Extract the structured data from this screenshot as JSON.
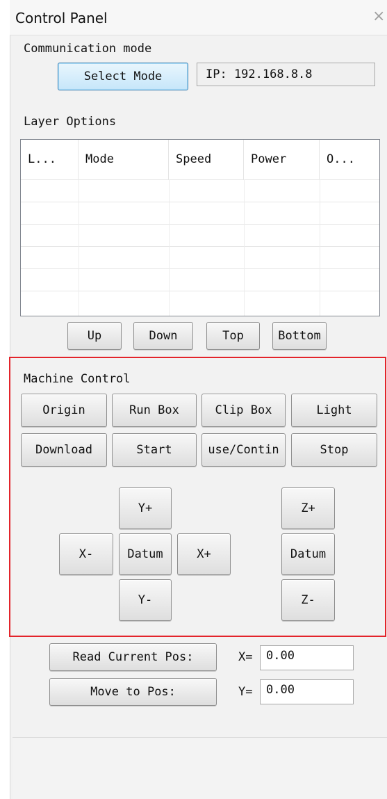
{
  "window": {
    "title": "Control Panel",
    "close_glyph": "×"
  },
  "communication": {
    "label": "Communication mode",
    "select_mode_label": "Select Mode",
    "ip_text": "IP: 192.168.8.8"
  },
  "layers": {
    "label": "Layer Options",
    "columns": [
      "L...",
      "Mode",
      "Speed",
      "Power",
      "O..."
    ],
    "rows": [],
    "buttons": {
      "up": "Up",
      "down": "Down",
      "top": "Top",
      "bottom": "Bottom"
    }
  },
  "machine": {
    "label": "Machine Control",
    "origin": "Origin",
    "run_box": "Run Box",
    "clip_box": "Clip Box",
    "light": "Light",
    "download": "Download",
    "start": "Start",
    "pause_continue": "use/Contin",
    "stop": "Stop",
    "xy": {
      "y_plus": "Y+",
      "x_minus": "X-",
      "datum": "Datum",
      "x_plus": "X+",
      "y_minus": "Y-"
    },
    "z": {
      "z_plus": "Z+",
      "datum": "Datum",
      "z_minus": "Z-"
    }
  },
  "position": {
    "read_label": "Read Current Pos:",
    "move_label": "Move to Pos:",
    "x_label": "X=",
    "x_value": "0.00",
    "y_label": "Y=",
    "y_value": "0.00"
  },
  "colors": {
    "highlight": "#e3242b",
    "primary_button": "#c6e6fa"
  }
}
